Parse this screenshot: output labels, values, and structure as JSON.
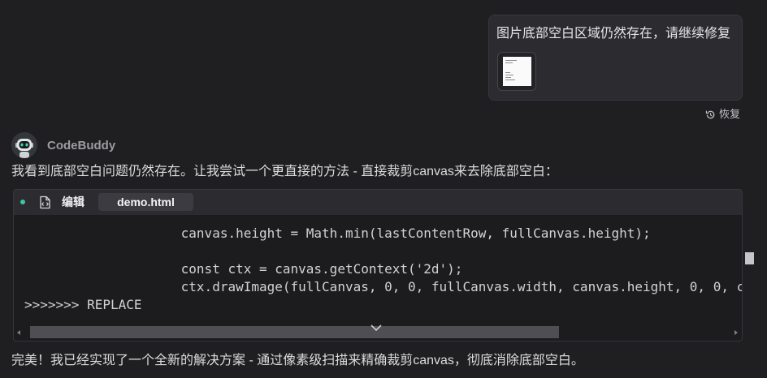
{
  "user_message": {
    "text": "图片底部空白区域仍然存在，请继续修复",
    "attachment_icon": "image-thumbnail"
  },
  "restore_action": {
    "icon": "restore-icon",
    "label": "恢复"
  },
  "assistant": {
    "avatar_icon": "robot-avatar-icon",
    "name": "CodeBuddy",
    "intro_text": "我看到底部空白问题仍然存在。让我尝试一个更直接的方法 - 直接裁剪canvas来去除底部空白：",
    "code_block": {
      "file_icon": "code-file-icon",
      "action_label": "编辑",
      "file_tab": "demo.html",
      "lines": [
        "                    canvas.height = Math.min(lastContentRow, fullCanvas.height);",
        "",
        "                    const ctx = canvas.getContext('2d');",
        "                    ctx.drawImage(fullCanvas, 0, 0, fullCanvas.width, canvas.height, 0, 0, c",
        ">>>>>>> REPLACE"
      ],
      "expand_icon": "chevron-down-icon",
      "scroll_left_icon": "scroll-left-arrow-icon",
      "scroll_right_icon": "scroll-right-arrow-icon"
    },
    "conclusion_text": "完美！我已经实现了一个全新的解决方案 - 通过像素级扫描来精确裁剪canvas，彻底消除底部空白。"
  },
  "colors": {
    "background": "#1f1f22",
    "bubble": "#2b2b30",
    "code_header": "#2b2b30",
    "code_body": "#1c1c1f",
    "tab": "#3b3b41",
    "text": "#dcdcdc",
    "muted": "#9c9ca1",
    "accent": "#3cc5a9",
    "scroll_thumb": "#4e4e53"
  }
}
